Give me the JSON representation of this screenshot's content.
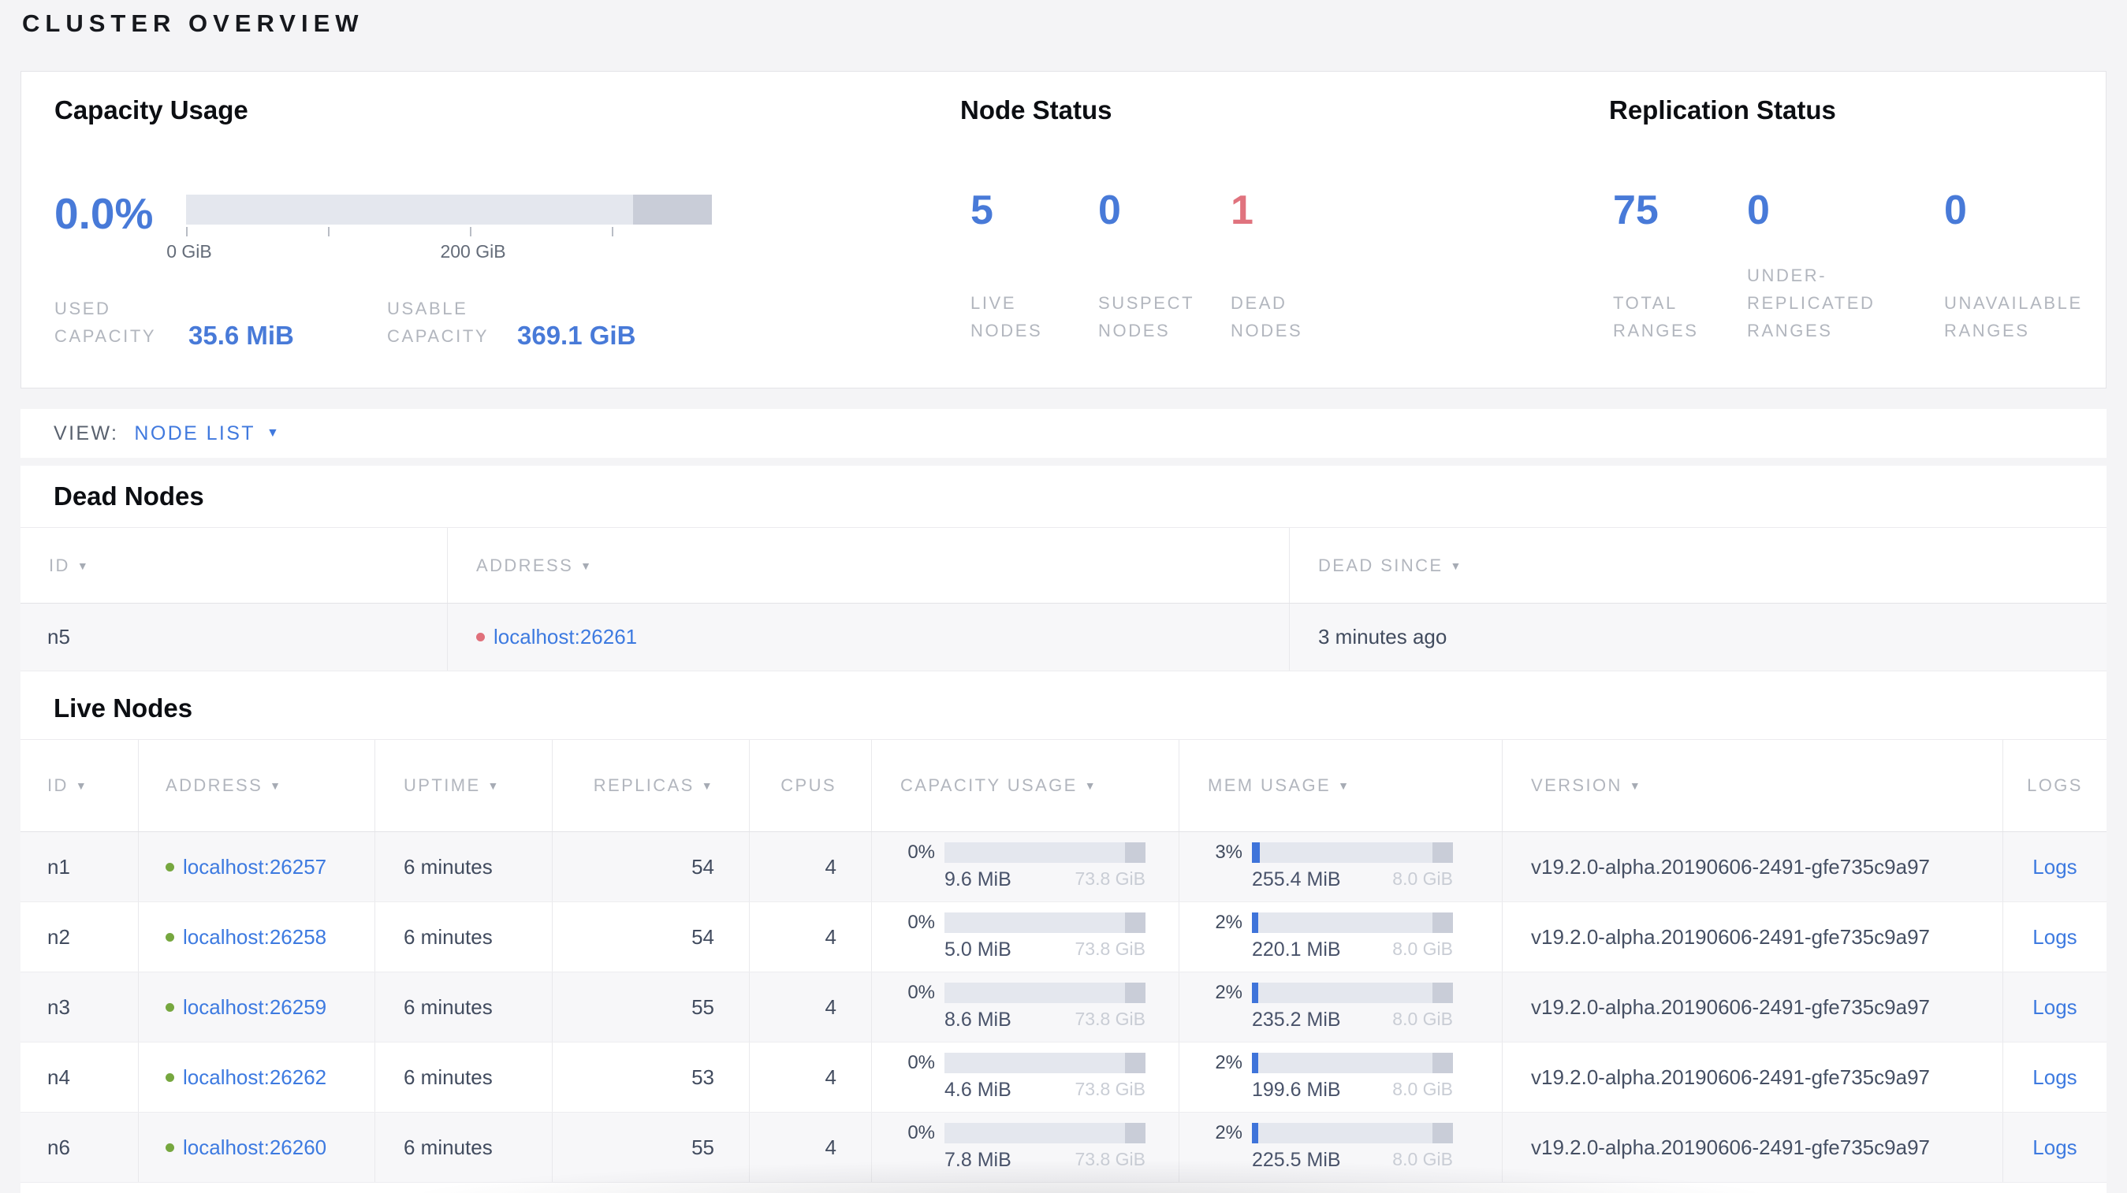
{
  "page_title": "CLUSTER OVERVIEW",
  "icons": {
    "sort_arrow": "▼",
    "dropdown_caret": "▼"
  },
  "colors": {
    "accent_blue": "#487ad8",
    "danger_red": "#e0737e",
    "live_dot_green": "#76a73f",
    "dead_dot_red": "#e0707b",
    "bar_track": "#e4e7ee",
    "bar_dark_segment": "#c9cdd8",
    "mem_fill_blue": "#3f74da"
  },
  "summary": {
    "capacity": {
      "title": "Capacity Usage",
      "percent": "0.0%",
      "axis_tick_0": "0 GiB",
      "axis_tick_200": "200 GiB",
      "used_label": "USED CAPACITY",
      "used_value": "35.6 MiB",
      "usable_label": "USABLE CAPACITY",
      "usable_value": "369.1 GiB"
    },
    "node_status": {
      "title": "Node Status",
      "stats": [
        {
          "value": "5",
          "label": "LIVE NODES"
        },
        {
          "value": "0",
          "label": "SUSPECT NODES"
        },
        {
          "value": "1",
          "label": "DEAD NODES"
        }
      ]
    },
    "replication": {
      "title": "Replication Status",
      "stats": [
        {
          "value": "75",
          "label": "TOTAL RANGES"
        },
        {
          "value": "0",
          "label": "UNDER-REPLICATED RANGES"
        },
        {
          "value": "0",
          "label": "UNAVAILABLE RANGES"
        }
      ]
    }
  },
  "view_bar": {
    "label": "VIEW:",
    "selected": "NODE LIST"
  },
  "dead_nodes": {
    "title": "Dead Nodes",
    "columns": [
      {
        "label": "ID"
      },
      {
        "label": "ADDRESS"
      },
      {
        "label": "DEAD SINCE"
      }
    ],
    "rows": [
      {
        "id": "n5",
        "address": "localhost:26261",
        "dead_since": "3 minutes ago"
      }
    ]
  },
  "live_nodes": {
    "title": "Live Nodes",
    "logs_label": "Logs",
    "columns": [
      {
        "label": "ID"
      },
      {
        "label": "ADDRESS"
      },
      {
        "label": "UPTIME"
      },
      {
        "label": "REPLICAS"
      },
      {
        "label": "CPUS"
      },
      {
        "label": "CAPACITY USAGE"
      },
      {
        "label": "MEM USAGE"
      },
      {
        "label": "VERSION"
      },
      {
        "label": "LOGS"
      }
    ],
    "rows": [
      {
        "id": "n1",
        "address": "localhost:26257",
        "uptime": "6 minutes",
        "replicas": "54",
        "cpus": "4",
        "capacity_percent": "0%",
        "capacity_used": "9.6 MiB",
        "capacity_total": "73.8 GiB",
        "mem_percent": "3%",
        "mem_used": "255.4 MiB",
        "mem_total": "8.0 GiB",
        "version": "v19.2.0-alpha.20190606-2491-gfe735c9a97"
      },
      {
        "id": "n2",
        "address": "localhost:26258",
        "uptime": "6 minutes",
        "replicas": "54",
        "cpus": "4",
        "capacity_percent": "0%",
        "capacity_used": "5.0 MiB",
        "capacity_total": "73.8 GiB",
        "mem_percent": "2%",
        "mem_used": "220.1 MiB",
        "mem_total": "8.0 GiB",
        "version": "v19.2.0-alpha.20190606-2491-gfe735c9a97"
      },
      {
        "id": "n3",
        "address": "localhost:26259",
        "uptime": "6 minutes",
        "replicas": "55",
        "cpus": "4",
        "capacity_percent": "0%",
        "capacity_used": "8.6 MiB",
        "capacity_total": "73.8 GiB",
        "mem_percent": "2%",
        "mem_used": "235.2 MiB",
        "mem_total": "8.0 GiB",
        "version": "v19.2.0-alpha.20190606-2491-gfe735c9a97"
      },
      {
        "id": "n4",
        "address": "localhost:26262",
        "uptime": "6 minutes",
        "replicas": "53",
        "cpus": "4",
        "capacity_percent": "0%",
        "capacity_used": "4.6 MiB",
        "capacity_total": "73.8 GiB",
        "mem_percent": "2%",
        "mem_used": "199.6 MiB",
        "mem_total": "8.0 GiB",
        "version": "v19.2.0-alpha.20190606-2491-gfe735c9a97"
      },
      {
        "id": "n6",
        "address": "localhost:26260",
        "uptime": "6 minutes",
        "replicas": "55",
        "cpus": "4",
        "capacity_percent": "0%",
        "capacity_used": "7.8 MiB",
        "capacity_total": "73.8 GiB",
        "mem_percent": "2%",
        "mem_used": "225.5 MiB",
        "mem_total": "8.0 GiB",
        "version": "v19.2.0-alpha.20190606-2491-gfe735c9a97"
      }
    ]
  }
}
